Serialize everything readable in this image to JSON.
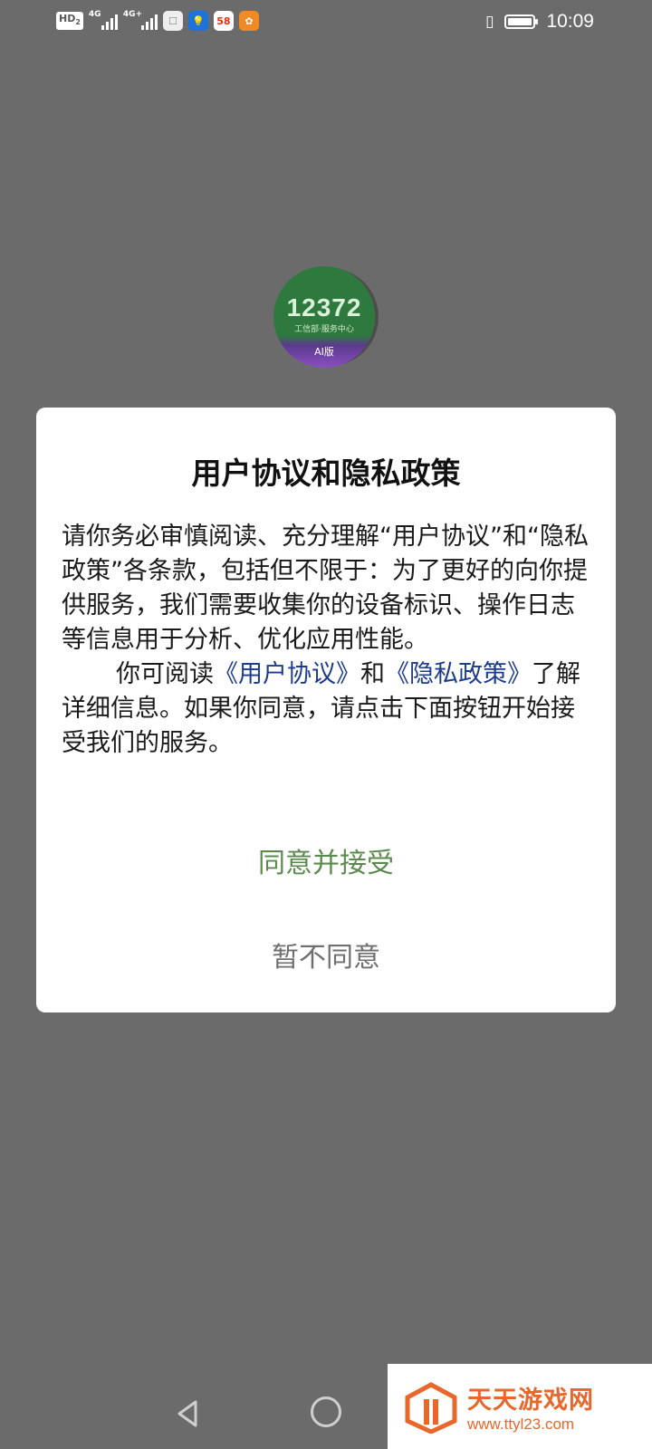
{
  "status_bar": {
    "hd": "HD",
    "hd_sub": "2",
    "net1": "4G",
    "net2": "4G+",
    "app_icon_58": "58",
    "time": "10:09",
    "battery_level": 0.85
  },
  "logo": {
    "number": "12372",
    "tagline": "工信部·服务中心",
    "ai_label": "AI版"
  },
  "dialog": {
    "title": "用户协议和隐私政策",
    "para1": "请你务必审慎阅读、充分理解“用户协议”和“隐私政策”各条款，包括但不限于：为了更好的向你提供服务，我们需要收集你的设备标识、操作日志等信息用于分析、优化应用性能。",
    "para2_prefix": "你可阅读",
    "link_user_agreement": "《用户协议》",
    "para2_and": "和",
    "link_privacy_policy": "《隐私政策》",
    "para2_suffix": "了解详细信息。如果你同意，请点击下面按钮开始接受我们的服务。",
    "accept_label": "同意并接受",
    "decline_label": "暂不同意"
  },
  "watermark": {
    "title": "天天游戏网",
    "url": "www.ttyl23.com"
  },
  "colors": {
    "overlay": "#6b6b6b",
    "accept": "#5b8a4e",
    "link": "#1d3c8f",
    "watermark": "#e8672a"
  }
}
